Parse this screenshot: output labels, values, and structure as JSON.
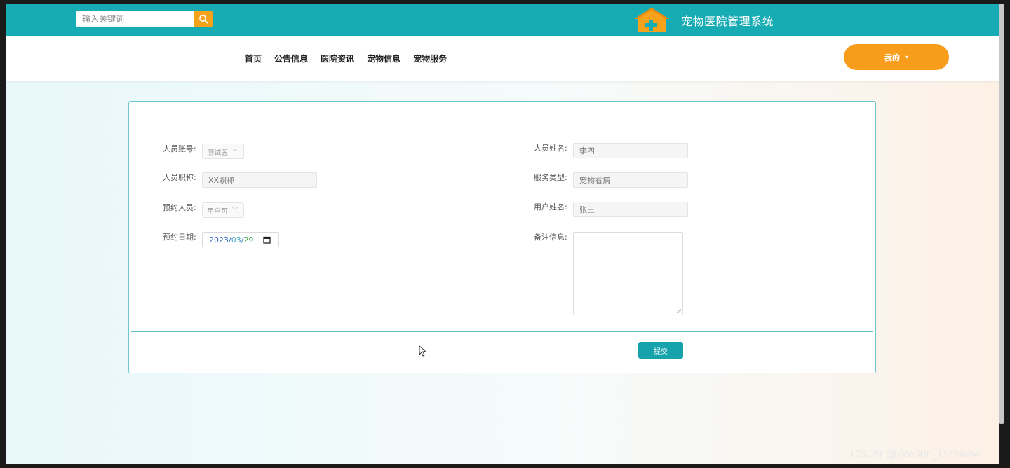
{
  "header": {
    "search_placeholder": "输入关键词",
    "site_title": "宠物医院管理系统",
    "brand_color": "#17abb4"
  },
  "nav": {
    "items": [
      "首页",
      "公告信息",
      "医院资讯",
      "宠物信息",
      "宠物服务"
    ],
    "my_label": "我的",
    "my_color": "#f89c1c"
  },
  "form": {
    "staff_account": {
      "label": "人员账号:",
      "value": "测试医"
    },
    "staff_name": {
      "label": "人员姓名:",
      "value": "李四"
    },
    "staff_title": {
      "label": "人员职称:",
      "value": "XX职称"
    },
    "service_type": {
      "label": "服务类型:",
      "value": "宠物看病"
    },
    "booker": {
      "label": "预约人员:",
      "value": "用户可"
    },
    "user_name": {
      "label": "用户姓名:",
      "value": "张三"
    },
    "booking_date": {
      "label": "预约日期:",
      "year": "2023",
      "month": "03",
      "day": "29"
    },
    "remarks": {
      "label": "备注信息:",
      "value": ""
    },
    "submit_label": "提交"
  },
  "watermark": "CSDN @WeiXin_DZbishe"
}
